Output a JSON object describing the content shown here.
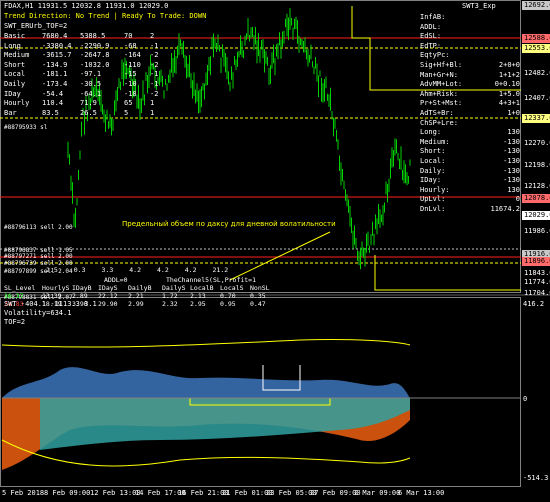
{
  "chart_header": "FDAX,H1  11931.5 12032.8 11931.0 12029.0",
  "trend_line": "Trend Direction:  No Trend  |  Ready To Trade:  DOWN",
  "indicator_title": "SWT_ERUrb_TOF=2",
  "indicator_label_right": "SWT3_Exp",
  "rows_left": [
    {
      "label": "Basic",
      "v1": "7680.4",
      "v2": "5388.5",
      "v3": "70",
      "v4": "2"
    },
    {
      "label": "Long",
      "v1": "-3380.4",
      "v2": "-2290.9",
      "v3": "-68",
      "v4": "-1"
    },
    {
      "label": "Medium",
      "v1": "-3615.7",
      "v2": "-2647.8",
      "v3": "-164",
      "v4": "-2"
    },
    {
      "label": "Short",
      "v1": "-134.9",
      "v2": "-1032.0",
      "v3": "-110",
      "v4": "-2"
    },
    {
      "label": "Local",
      "v1": "-181.1",
      "v2": "-97.1",
      "v3": "-15",
      "v4": "-1"
    },
    {
      "label": "Daily",
      "v1": "-173.4",
      "v2": "-30.5",
      "v3": "-10",
      "v4": "-1"
    },
    {
      "label": "IDay",
      "v1": "-54.4",
      "v2": "-64.1",
      "v3": "-18",
      "v4": "-2"
    },
    {
      "label": "Hourly",
      "v1": "110.4",
      "v2": "71.9",
      "v3": "65",
      "v4": "1"
    },
    {
      "label": "Bar",
      "v1": "83.5",
      "v2": "26.5",
      "v3": "5",
      "v4": "1"
    }
  ],
  "rows_right": [
    {
      "label": "InfAB:",
      "value": ""
    },
    {
      "label": "ADDL:",
      "value": ""
    },
    {
      "label": "EdSL:",
      "value": ""
    },
    {
      "label": "EdTP:",
      "value": ""
    },
    {
      "label": "EqtyPc:",
      "value": ""
    },
    {
      "label": "Sig+Hf+Bl:",
      "value": "2+0+0"
    },
    {
      "label": "Man+Gr+N:",
      "value": "1+1+2"
    },
    {
      "label": "AdvMM+Lot:",
      "value": "0+0.10"
    },
    {
      "label": "Ahm+Risk:",
      "value": "1+5.0"
    },
    {
      "label": "Pr+St+Mst:",
      "value": "4+3+1"
    },
    {
      "label": "AdTS+Br:",
      "value": "1+0"
    },
    {
      "label": "ChSP+Lre:",
      "value": ""
    },
    {
      "label": "Long:",
      "value": "130"
    },
    {
      "label": "Medium:",
      "value": "-130"
    },
    {
      "label": "Short:",
      "value": "-130"
    },
    {
      "label": "Local:",
      "value": "-130"
    },
    {
      "label": "Daily:",
      "value": "-130"
    },
    {
      "label": "IDay:",
      "value": "-130"
    },
    {
      "label": "Hourly:",
      "value": "130"
    },
    {
      "label": "UpLvl:",
      "value": "0"
    },
    {
      "label": "DnLvl:",
      "value": "11674.2"
    }
  ],
  "price_levels": [
    {
      "price": "12692.0",
      "bg": "#c8c8c8"
    },
    {
      "price": "12588.0",
      "bg": "#ff6a6a"
    },
    {
      "price": "12553.0",
      "bg": "#ffff80"
    },
    {
      "price": "12482.0",
      "bg": null
    },
    {
      "price": "12407.0",
      "bg": null
    },
    {
      "price": "12337.0",
      "bg": "#ffff80"
    },
    {
      "price": "12270.0",
      "bg": null
    },
    {
      "price": "12198.0",
      "bg": null
    },
    {
      "price": "12128.0",
      "bg": null
    },
    {
      "price": "12078.0",
      "bg": "#ff6a6a"
    },
    {
      "price": "12029.0",
      "bg": "#ffffff"
    },
    {
      "price": "11986.0",
      "bg": null
    },
    {
      "price": "11916.0",
      "bg": "#c8c8c8"
    },
    {
      "price": "11896.0",
      "bg": "#ff6a6a"
    },
    {
      "price": "11843.0",
      "bg": null
    },
    {
      "price": "11774.0",
      "bg": null
    },
    {
      "price": "11704.0",
      "bg": null
    }
  ],
  "annotation_text": "Предельный объем по даксу для дневной волатильности",
  "mid_labels": [
    "#88796113 sell 2.00",
    "#88796837 sell 1.05",
    "#88797271 sell 2.00",
    "#88796739 sell 2.00",
    "#88797899 sell 2.04",
    "#88798831 sell 2.07",
    "#88795933 sl"
  ],
  "addl_label": "ADDL=0",
  "addl_row": [
    "2.5",
    "0.3",
    "3.3",
    "4.2",
    "4.2",
    "4.2",
    "21.2"
  ],
  "channel_label": "TheChannel5(SL,Profit=1",
  "bottom_table": {
    "headers": [
      "SL_Level",
      "HourlyS",
      "IDayB",
      "IDayS",
      "DailyB",
      "DailyS",
      "LocalB",
      "LocalS",
      "NonSL"
    ],
    "rows": [
      [
        "16.37",
        "13.39",
        "2.89",
        "22.12",
        "2.21",
        "1.72",
        "2.13",
        "0.70",
        "0.35"
      ],
      [
        "24.83",
        "18.19",
        "3.90",
        "29.90",
        "2.99",
        "2.32",
        "2.95",
        "0.95",
        "0.47"
      ]
    ]
  },
  "sub_header": "SWT -404.1 -1113.3 3.1",
  "sub_vol": "Volatility=634.1",
  "sub_tof": "TOF=2",
  "sub_scale": [
    "416.2",
    "0",
    "-514.3"
  ],
  "x_labels": [
    "5 Feb 2018",
    "8 Feb 09:00",
    "12 Feb 13:00",
    "14 Feb 17:00",
    "16 Feb 21:00",
    "21 Feb 01:00",
    "23 Feb 05:00",
    "27 Feb 09:00",
    "2 Mar 09:00",
    "6 Mar 13:00"
  ],
  "colors": {
    "candle": "#00d000",
    "yellow": "#ffff00",
    "red": "#ff2020",
    "steel": "#3a6fb0",
    "teal": "#30a0a0",
    "orange": "#e05a10"
  }
}
